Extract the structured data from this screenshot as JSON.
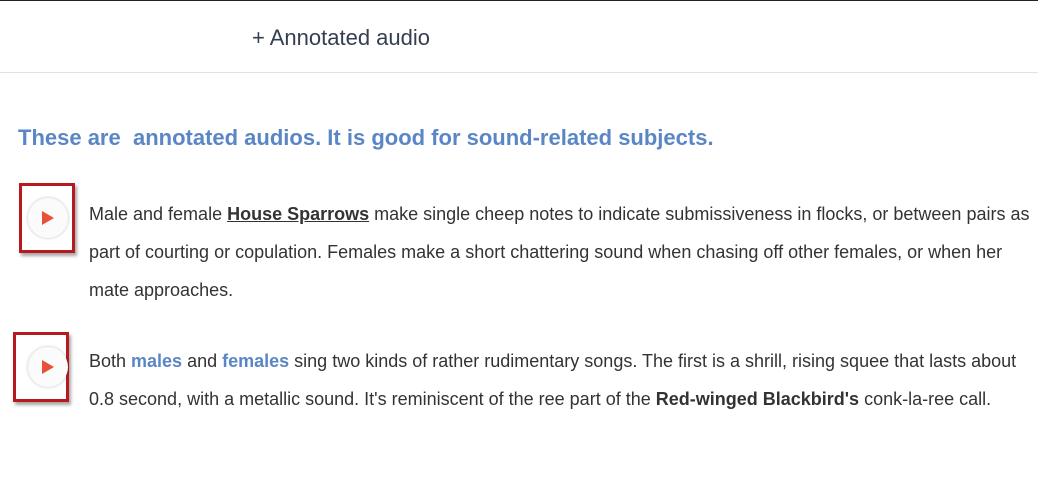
{
  "header": {
    "add_annotated_audio_label": "+ Annotated audio"
  },
  "headline": {
    "part1": "These are  ",
    "part2": "annotated audios",
    "part3": ". It is good for sound-related subjects",
    "part4": "."
  },
  "audio_items": [
    {
      "play_icon": "play-icon",
      "seg1": "Male and female ",
      "link1": "House Sparrows",
      "seg2": " make single cheep notes to indicate submissiveness in flocks, or between pairs as part of courting or copulation. Females make a short chattering sound when chasing off other females, or when her mate approaches."
    },
    {
      "play_icon": "play-icon",
      "seg1": "Both ",
      "link1": "males",
      "seg2": " and ",
      "link2": "females",
      "seg3": " sing two kinds of rather rudimentary songs. The first is a shrill, rising squee that lasts about 0.8 second, with a metallic sound. It's reminiscent of the ree part of the ",
      "bold1": "Red-winged Blackbird's",
      "seg4": " conk-la-ree call."
    }
  ],
  "colors": {
    "headline": "#5b86c5",
    "link": "#5b86c5",
    "frame": "#b7191f",
    "play": "#e8503a",
    "text": "#333333"
  }
}
